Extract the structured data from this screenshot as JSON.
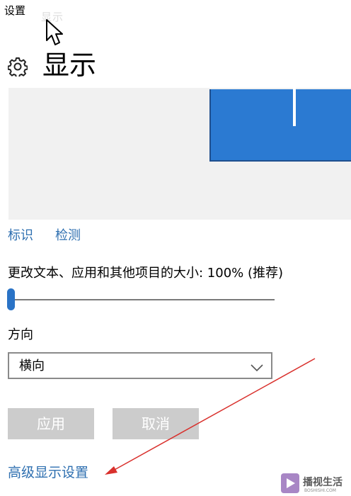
{
  "window": {
    "title": "设置",
    "breadcrumb_faded": "显示"
  },
  "header": {
    "icon": "gear-icon",
    "title": "显示"
  },
  "preview": {
    "monitor_color": "#2b7ad2",
    "background_color": "#f1f1f1"
  },
  "links": {
    "identify": "标识",
    "detect": "检测",
    "advanced": "高级显示设置"
  },
  "scale": {
    "label": "更改文本、应用和其他项目的大小: 100% (推荐)",
    "slider_level": 0
  },
  "orientation": {
    "label": "方向",
    "selected": "横向"
  },
  "buttons": {
    "apply": "应用",
    "cancel": "取消"
  },
  "annotation": {
    "arrow_color": "#d9302c"
  },
  "watermark": {
    "text": "播视生活",
    "subtext": "BOSHISHI.COM"
  }
}
